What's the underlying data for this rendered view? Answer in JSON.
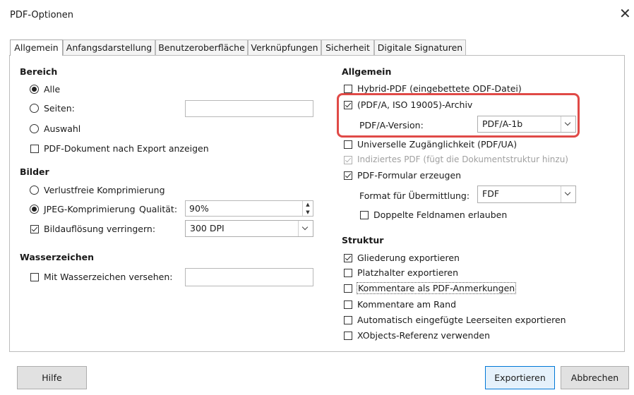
{
  "window": {
    "title": "PDF-Optionen",
    "close_glyph": "✕"
  },
  "tabs": [
    {
      "label": "Allgemein"
    },
    {
      "label": "Anfangsdarstellung"
    },
    {
      "label": "Benutzeroberfläche"
    },
    {
      "label": "Verknüpfungen"
    },
    {
      "label": "Sicherheit"
    },
    {
      "label": "Digitale Signaturen"
    }
  ],
  "left": {
    "bereich": {
      "heading": "Bereich",
      "all": "Alle",
      "pages": "Seiten:",
      "pages_value": "",
      "selection": "Auswahl",
      "show_pdf": "PDF-Dokument nach Export anzeigen",
      "selected": "all",
      "show_pdf_checked": false
    },
    "bilder": {
      "heading": "Bilder",
      "lossless": "Verlustfreie Komprimierung",
      "jpeg": "JPEG-Komprimierung",
      "quality_label": "Qualität:",
      "quality_value": "90%",
      "reduce": "Bildauflösung verringern:",
      "reduce_checked": true,
      "dpi": "300 DPI",
      "selected": "jpeg"
    },
    "wasserzeichen": {
      "heading": "Wasserzeichen",
      "sign": "Mit Wasserzeichen versehen:",
      "sign_checked": false,
      "sign_value": ""
    }
  },
  "right": {
    "allgemein": {
      "heading": "Allgemein",
      "hybrid": "Hybrid-PDF (eingebettete ODF-Datei)",
      "hybrid_checked": false,
      "pdfa": "(PDF/A, ISO 19005)-Archiv",
      "pdfa_checked": true,
      "pdfa_version_label": "PDF/A-Version:",
      "pdfa_version": "PDF/A-1b",
      "ua": "Universelle Zugänglichkeit (PDF/UA)",
      "ua_checked": false,
      "tagged": "Indiziertes PDF (fügt die Dokumentstruktur hinzu)",
      "tagged_checked": true,
      "form": "PDF-Formular erzeugen",
      "form_checked": true,
      "format_label": "Format für Übermittlung:",
      "format_value": "FDF",
      "dup": "Doppelte Feldnamen erlauben",
      "dup_checked": false
    },
    "struktur": {
      "heading": "Struktur",
      "outline": "Gliederung exportieren",
      "outline_checked": true,
      "placeholders": "Platzhalter exportieren",
      "comments_pdf": "Kommentare als PDF-Anmerkungen",
      "comments_margin": "Kommentare am Rand",
      "blank_pages": "Automatisch eingefügte Leerseiten exportieren",
      "xobjects": "XObjects-Referenz verwenden"
    }
  },
  "buttons": {
    "help": "Hilfe",
    "export": "Exportieren",
    "cancel": "Abbrechen"
  },
  "colors": {
    "highlight": "#e04a47",
    "primary_border": "#0078d7"
  }
}
